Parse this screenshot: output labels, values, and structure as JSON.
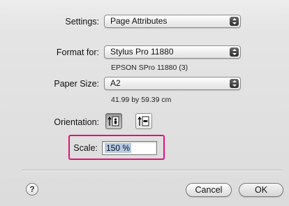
{
  "settings": {
    "label": "Settings:",
    "value": "Page Attributes"
  },
  "format_for": {
    "label": "Format for:",
    "value": "Stylus Pro 11880",
    "detail": "EPSON SPro 11880 (3)"
  },
  "paper_size": {
    "label": "Paper Size:",
    "value": "A2",
    "detail": "41.99 by 59.39 cm"
  },
  "orientation": {
    "label": "Orientation:",
    "selected": "portrait"
  },
  "scale": {
    "label": "Scale:",
    "value": "150 %"
  },
  "help": {
    "glyph": "?"
  },
  "buttons": {
    "cancel": "Cancel",
    "ok": "OK"
  },
  "colors": {
    "highlight": "#e0117a",
    "selection": "#b4c9e4"
  }
}
